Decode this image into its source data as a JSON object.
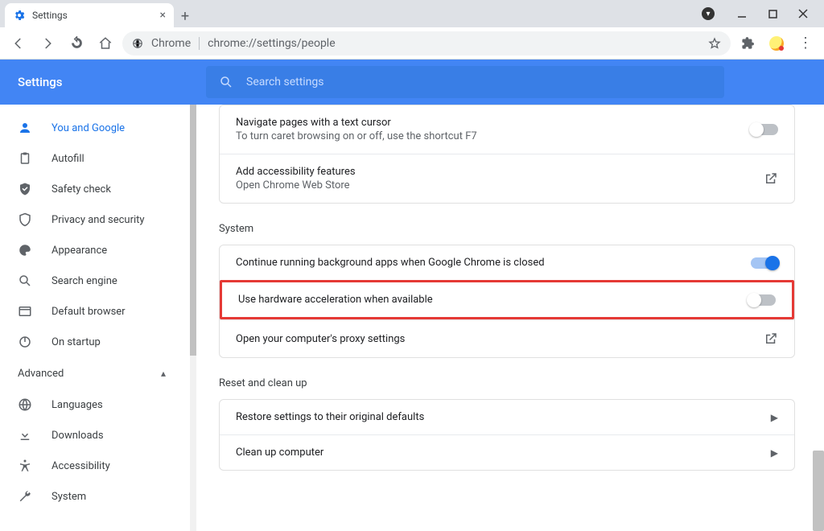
{
  "window": {
    "tab_title": "Settings",
    "omnibox_prefix": "Chrome",
    "omnibox_url": "chrome://settings/people"
  },
  "header": {
    "title": "Settings",
    "search_placeholder": "Search settings"
  },
  "sidebar": {
    "items": [
      {
        "label": "You and Google"
      },
      {
        "label": "Autofill"
      },
      {
        "label": "Safety check"
      },
      {
        "label": "Privacy and security"
      },
      {
        "label": "Appearance"
      },
      {
        "label": "Search engine"
      },
      {
        "label": "Default browser"
      },
      {
        "label": "On startup"
      }
    ],
    "advanced_label": "Advanced",
    "adv_items": [
      {
        "label": "Languages"
      },
      {
        "label": "Downloads"
      },
      {
        "label": "Accessibility"
      },
      {
        "label": "System"
      }
    ]
  },
  "content": {
    "top_rows": [
      {
        "title": "Navigate pages with a text cursor",
        "sub": "To turn caret browsing on or off, use the shortcut F7",
        "toggle": "off"
      },
      {
        "title": "Add accessibility features",
        "sub": "Open Chrome Web Store",
        "action": "external"
      }
    ],
    "system_title": "System",
    "system_rows": [
      {
        "title": "Continue running background apps when Google Chrome is closed",
        "toggle": "on"
      },
      {
        "title": "Use hardware acceleration when available",
        "toggle": "off",
        "highlight": true
      },
      {
        "title": "Open your computer's proxy settings",
        "action": "external"
      }
    ],
    "reset_title": "Reset and clean up",
    "reset_rows": [
      {
        "title": "Restore settings to their original defaults"
      },
      {
        "title": "Clean up computer"
      }
    ]
  }
}
